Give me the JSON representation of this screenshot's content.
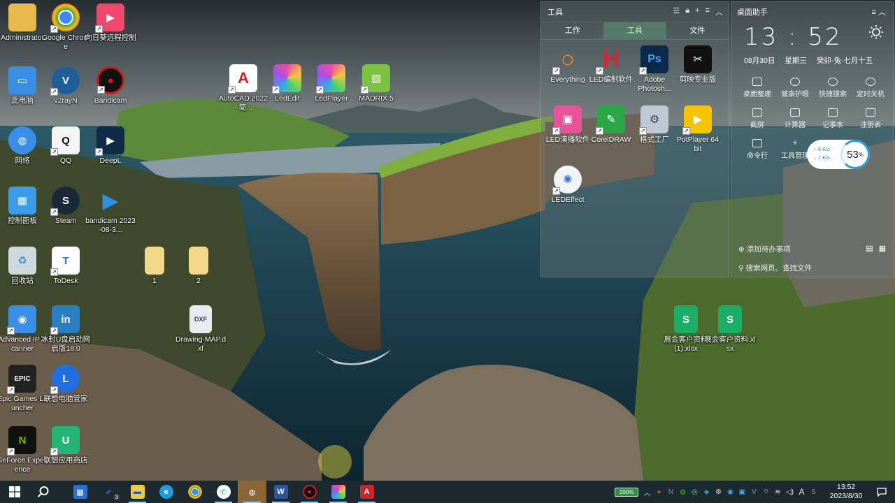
{
  "desktop_icons": [
    {
      "label": "Administrator",
      "icon": "folder-user-icon",
      "color": "#e8b84a"
    },
    {
      "label": "Google Chrome",
      "icon": "chrome-icon",
      "color": "#4285f4"
    },
    {
      "label": "向日葵远程控制",
      "icon": "sunflower-remote-icon",
      "color": "#f0486e"
    },
    {
      "label": "此电脑",
      "icon": "computer-icon",
      "color": "#3a8ee6"
    },
    {
      "label": "v2rayN",
      "icon": "v2rayn-icon",
      "color": "#1e5f9a"
    },
    {
      "label": "Bandicam",
      "icon": "bandicam-icon",
      "color": "#d11a1a"
    },
    {
      "label": "网络",
      "icon": "network-icon",
      "color": "#3a8ee6"
    },
    {
      "label": "QQ",
      "icon": "qq-icon",
      "color": "#f5f5f5"
    },
    {
      "label": "DeepL",
      "icon": "deepl-icon",
      "color": "#0f2b46"
    },
    {
      "label": "控制面板",
      "icon": "control-panel-icon",
      "color": "#3c9be6"
    },
    {
      "label": "Steam",
      "icon": "steam-icon",
      "color": "#1b2838"
    },
    {
      "label": "bandicam 2023-08-3...",
      "icon": "video-file-icon",
      "color": "#2f8fe0"
    },
    {
      "label": "回收站",
      "icon": "recycle-bin-icon",
      "color": "#cfd8dc"
    },
    {
      "label": "ToDesk",
      "icon": "todesk-icon",
      "color": "#1f7ae0"
    },
    {
      "label": "1",
      "icon": "folder-icon",
      "color": "#f3d88a"
    },
    {
      "label": "2",
      "icon": "folder-icon",
      "color": "#f3d88a"
    },
    {
      "label": "Advanced IP Scanner",
      "icon": "ip-scanner-icon",
      "color": "#3a8ee6"
    },
    {
      "label": "冰封U盘启动网启版18.0",
      "icon": "usb-boot-icon",
      "color": "#2a7fc4"
    },
    {
      "label": "Drawing-MAP.dxf",
      "icon": "dxf-file-icon",
      "color": "#6a7a86"
    },
    {
      "label": "Epic Games Launcher",
      "icon": "epic-games-icon",
      "color": "#222222"
    },
    {
      "label": "联想电脑管家",
      "icon": "lenovo-manager-icon",
      "color": "#1f6fe0"
    },
    {
      "label": "GeForce Experience",
      "icon": "geforce-icon",
      "color": "#76b900"
    },
    {
      "label": "联想应用商店",
      "icon": "lenovo-store-icon",
      "color": "#22b573"
    },
    {
      "label": "AutoCAD 2022 - 简...",
      "icon": "autocad-icon",
      "color": "#c8262c"
    },
    {
      "label": "LedEdit",
      "icon": "ledit-icon",
      "color": "#e94fa0"
    },
    {
      "label": "LedPlayer",
      "icon": "ledplayer-icon",
      "color": "#e94fa0"
    },
    {
      "label": "MADRIX 5",
      "icon": "madrix-icon",
      "color": "#7cc242"
    },
    {
      "label": "展会客户资料(1).xlsx",
      "icon": "xlsx-icon",
      "color": "#1aae67"
    },
    {
      "label": "展会客户资料.xlsx",
      "icon": "xlsx-icon",
      "color": "#1aae67"
    }
  ],
  "desktop_glyphs": [
    "",
    "",
    "",
    "▭",
    "V",
    "●",
    "◍",
    "Q",
    "▶",
    "▦",
    "S",
    "▶",
    "♻",
    "T",
    "",
    "",
    "◉",
    "in",
    "DXF",
    "EPIC",
    "L",
    "N",
    "U",
    "A",
    "◎",
    "◎",
    "▧",
    "S",
    "S"
  ],
  "tool_panel": {
    "title": "工具",
    "tabs": [
      "工作",
      "工具",
      "文件"
    ],
    "active_tab": 1,
    "apps": [
      {
        "label": "Everything",
        "icon": "everything-icon",
        "color": "#f08a1c",
        "glyph": "○"
      },
      {
        "label": "LED编制软件",
        "icon": "led-edit-software-icon",
        "color": "#d6282f",
        "glyph": "H"
      },
      {
        "label": "Adobe Photosh...",
        "icon": "photoshop-icon",
        "color": "#0b2a4a",
        "glyph": "Ps"
      },
      {
        "label": "剪映专业版",
        "icon": "capcut-icon",
        "color": "#111111",
        "glyph": "✂"
      },
      {
        "label": "LED演播软件",
        "icon": "led-play-software-icon",
        "color": "#e8529a",
        "glyph": "▣"
      },
      {
        "label": "CorelDRAW",
        "icon": "coreldraw-icon",
        "color": "#2aa845",
        "glyph": "✎"
      },
      {
        "label": "格式工厂",
        "icon": "format-factory-icon",
        "color": "#bfc9d6",
        "glyph": "⚙"
      },
      {
        "label": "PotPlayer 64 bit",
        "icon": "potplayer-icon",
        "color": "#f5c400",
        "glyph": "▶"
      },
      {
        "label": "LEDEffect",
        "icon": "ledeffect-icon",
        "color": "#f0f4f4",
        "glyph": "💡"
      }
    ]
  },
  "assistant_panel": {
    "title": "桌面助手",
    "time": "13 : 52",
    "date": "08月30日",
    "weekday": "星期三",
    "lunar": "癸卯·兔·七月十五",
    "tools": [
      "桌面整理",
      "健康护眼",
      "快捷搜索",
      "定时关机",
      "截屏",
      "计算器",
      "记事本",
      "注册表",
      "命令行",
      "工具管理"
    ],
    "net_up": "↑ 6  K/s",
    "net_down": "↓ 1  K/s",
    "net_pct": "53",
    "net_pct_unit": "%",
    "todo": "添加待办事项",
    "search": "搜索网页、查找文件"
  },
  "taskbar": {
    "apps": [
      {
        "name": "explorer-store",
        "icon": "store-icon",
        "color": "#2b6fd6",
        "glyph": "▦"
      },
      {
        "name": "todo",
        "icon": "todo-icon",
        "color": "#3a7bd5",
        "glyph": "✔",
        "badge": "3"
      },
      {
        "name": "file-explorer",
        "icon": "folder-icon",
        "color": "#f3c845",
        "glyph": "▬"
      },
      {
        "name": "edge",
        "icon": "edge-icon",
        "color": "#1f9be0",
        "glyph": "e"
      },
      {
        "name": "chrome",
        "icon": "chrome-icon",
        "color": "#e8453c",
        "glyph": "◉"
      },
      {
        "name": "whatsapp",
        "icon": "whatsapp-icon",
        "color": "#25d366",
        "glyph": "✆"
      },
      {
        "name": "wechat",
        "icon": "wechat-icon",
        "color": "#2dc100",
        "glyph": "◍"
      },
      {
        "name": "word",
        "icon": "word-icon",
        "color": "#2b579a",
        "glyph": "W"
      },
      {
        "name": "bandicam",
        "icon": "bandicam-icon",
        "color": "#cc1f1f",
        "glyph": "●"
      },
      {
        "name": "ledplayer",
        "icon": "ledplayer-icon",
        "color": "#e94fa0",
        "glyph": "◎"
      },
      {
        "name": "autocad",
        "icon": "autocad-icon",
        "color": "#c8262c",
        "glyph": "A"
      }
    ],
    "battery": "100%",
    "clock_time": "13:52",
    "clock_date": "2023/8/30"
  },
  "colors": {
    "taskbar_bg": "#1b2a2e",
    "panel_bg": "rgba(105,120,118,0.42)",
    "tab_active": "#c8f5c8"
  }
}
